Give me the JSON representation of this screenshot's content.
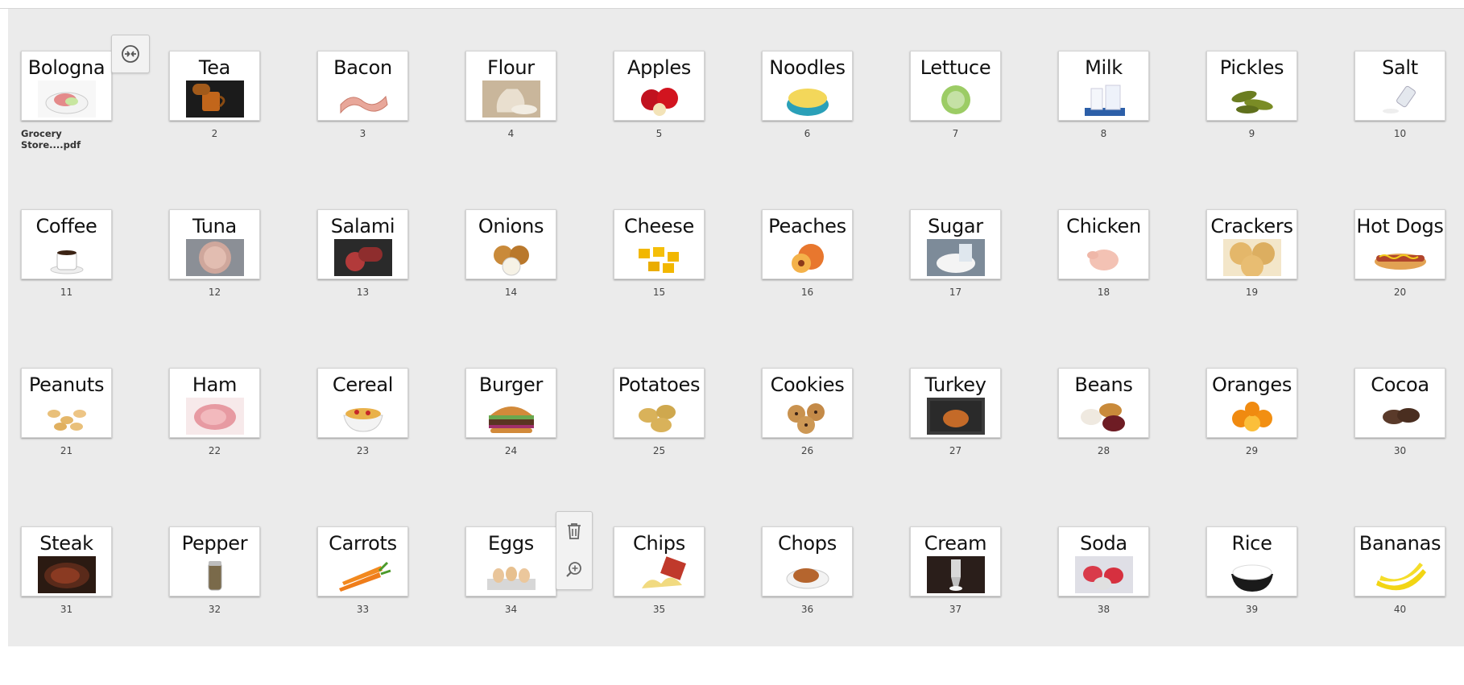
{
  "file_label": "Grocery Store....pdf",
  "pages": [
    {
      "title": "Bologna",
      "num": "",
      "pic": "plate-meat"
    },
    {
      "title": "Tea",
      "num": "2",
      "pic": "tea"
    },
    {
      "title": "Bacon",
      "num": "3",
      "pic": "bacon"
    },
    {
      "title": "Flour",
      "num": "4",
      "pic": "flour"
    },
    {
      "title": "Apples",
      "num": "5",
      "pic": "apples"
    },
    {
      "title": "Noodles",
      "num": "6",
      "pic": "noodles"
    },
    {
      "title": "Lettuce",
      "num": "7",
      "pic": "lettuce"
    },
    {
      "title": "Milk",
      "num": "8",
      "pic": "milk"
    },
    {
      "title": "Pickles",
      "num": "9",
      "pic": "pickles"
    },
    {
      "title": "Salt",
      "num": "10",
      "pic": "salt"
    },
    {
      "title": "Coffee",
      "num": "11",
      "pic": "coffee"
    },
    {
      "title": "Tuna",
      "num": "12",
      "pic": "tuna"
    },
    {
      "title": "Salami",
      "num": "13",
      "pic": "salami"
    },
    {
      "title": "Onions",
      "num": "14",
      "pic": "onions"
    },
    {
      "title": "Cheese",
      "num": "15",
      "pic": "cheese"
    },
    {
      "title": "Peaches",
      "num": "16",
      "pic": "peaches"
    },
    {
      "title": "Sugar",
      "num": "17",
      "pic": "sugar"
    },
    {
      "title": "Chicken",
      "num": "18",
      "pic": "chicken"
    },
    {
      "title": "Crackers",
      "num": "19",
      "pic": "crackers"
    },
    {
      "title": "Hot Dogs",
      "num": "20",
      "pic": "hotdog"
    },
    {
      "title": "Peanuts",
      "num": "21",
      "pic": "peanuts"
    },
    {
      "title": "Ham",
      "num": "22",
      "pic": "ham"
    },
    {
      "title": "Cereal",
      "num": "23",
      "pic": "cereal"
    },
    {
      "title": "Burger",
      "num": "24",
      "pic": "burger"
    },
    {
      "title": "Potatoes",
      "num": "25",
      "pic": "potatoes"
    },
    {
      "title": "Cookies",
      "num": "26",
      "pic": "cookies"
    },
    {
      "title": "Turkey",
      "num": "27",
      "pic": "turkey"
    },
    {
      "title": "Beans",
      "num": "28",
      "pic": "beans"
    },
    {
      "title": "Oranges",
      "num": "29",
      "pic": "oranges"
    },
    {
      "title": "Cocoa",
      "num": "30",
      "pic": "cocoa"
    },
    {
      "title": "Steak",
      "num": "31",
      "pic": "steak"
    },
    {
      "title": "Pepper",
      "num": "32",
      "pic": "pepper"
    },
    {
      "title": "Carrots",
      "num": "33",
      "pic": "carrots"
    },
    {
      "title": "Eggs",
      "num": "34",
      "pic": "eggs"
    },
    {
      "title": "Chips",
      "num": "35",
      "pic": "chips"
    },
    {
      "title": "Chops",
      "num": "36",
      "pic": "chops"
    },
    {
      "title": "Cream",
      "num": "37",
      "pic": "cream"
    },
    {
      "title": "Soda",
      "num": "38",
      "pic": "soda"
    },
    {
      "title": "Rice",
      "num": "39",
      "pic": "rice"
    },
    {
      "title": "Bananas",
      "num": "40",
      "pic": "bananas"
    }
  ],
  "toolbar": {
    "collapse_icon": "collapse-arrows-icon",
    "delete_icon": "trash-icon",
    "zoom_icon": "zoom-in-icon"
  },
  "colors": {
    "canvas": "#ebebeb",
    "thumb_bg": "#ffffff"
  }
}
